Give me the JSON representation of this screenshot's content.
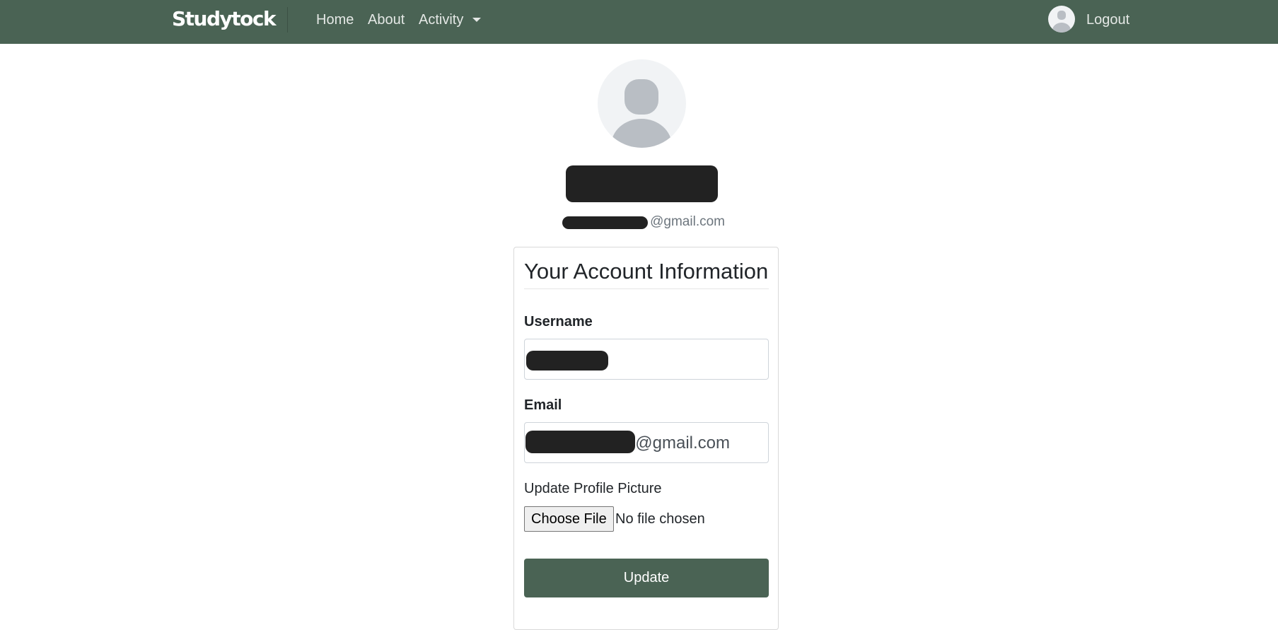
{
  "navbar": {
    "brand": "Studytock",
    "links": [
      {
        "label": "Home"
      },
      {
        "label": "About"
      },
      {
        "label": "Activity"
      }
    ],
    "logout_label": "Logout"
  },
  "profile": {
    "email_suffix": "@gmail.com"
  },
  "card": {
    "title": "Your Account Information",
    "username_label": "Username",
    "email_label": "Email",
    "email_value_suffix": "@gmail.com",
    "upload_label": "Update Profile Picture",
    "file_button_label": "Choose File",
    "file_status": "No file chosen",
    "submit_label": "Update"
  },
  "colors": {
    "navbar": "#4a6354",
    "button": "#4a6354",
    "avatar_bg": "#f1f3f5",
    "avatar_fg": "#b9bec4"
  },
  "icons": [
    "user-avatar-icon",
    "caret-down-icon"
  ]
}
